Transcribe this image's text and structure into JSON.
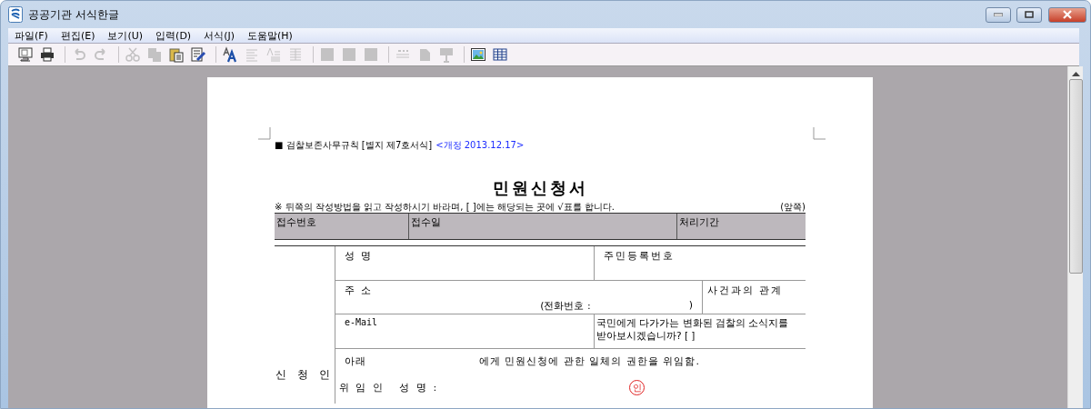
{
  "window": {
    "title": "공공기관 서식한글"
  },
  "menu": [
    "파일(F)",
    "편집(E)",
    "보기(U)",
    "입력(D)",
    "서식(J)",
    "도움말(H)"
  ],
  "toolbar": [
    [
      {
        "kind": "monitor",
        "disabled": false
      },
      {
        "kind": "printer",
        "disabled": false
      }
    ],
    [
      {
        "kind": "undo",
        "disabled": true
      },
      {
        "kind": "redo",
        "disabled": true
      }
    ],
    [
      {
        "kind": "scissors",
        "disabled": true
      },
      {
        "kind": "copy",
        "disabled": true
      },
      {
        "kind": "paste",
        "disabled": false
      },
      {
        "kind": "edit",
        "disabled": false
      }
    ],
    [
      {
        "kind": "font",
        "disabled": false
      },
      {
        "kind": "align",
        "disabled": true
      },
      {
        "kind": "style",
        "disabled": true
      },
      {
        "kind": "list",
        "disabled": true
      }
    ],
    [
      {
        "kind": "square",
        "disabled": true
      },
      {
        "kind": "square",
        "disabled": true
      },
      {
        "kind": "square",
        "disabled": true
      }
    ],
    [
      {
        "kind": "line",
        "disabled": true
      },
      {
        "kind": "shape",
        "disabled": true
      },
      {
        "kind": "easel",
        "disabled": true
      }
    ],
    [
      {
        "kind": "image",
        "disabled": false
      },
      {
        "kind": "table",
        "disabled": false
      }
    ]
  ],
  "document": {
    "header": "■ 검찰보존사무규칙 [별지 제7호서식]",
    "revision": "<개정 2013.12.17>",
    "title": "민원신청서",
    "note": "※ 뒤쪽의 작성방법을 읽고 작성하시기 바라며, [   ]에는 해당되는 곳에 √표를 합니다.",
    "side": "(앞쪽)",
    "office_row": [
      "접수번호",
      "접수일",
      "처리기간"
    ],
    "applicant": {
      "label": "신 청 인",
      "name": "성 명",
      "rrn": "주민등록번호",
      "address": "주 소",
      "phone": "(전화번호 :",
      "phone_close": ")",
      "relation": "사건과의 관계",
      "email": "e-Mail",
      "newsletter": "국민에게 다가가는 변화된 검찰의 소식지를\n받아보시겠습니까? [   ]",
      "delegation_lead": "아래",
      "delegation_text": "에게 민원신청에 관한 일체의 권한을 위임함.",
      "delegator": "위 임 인   성 명 :",
      "seal": "인"
    }
  }
}
